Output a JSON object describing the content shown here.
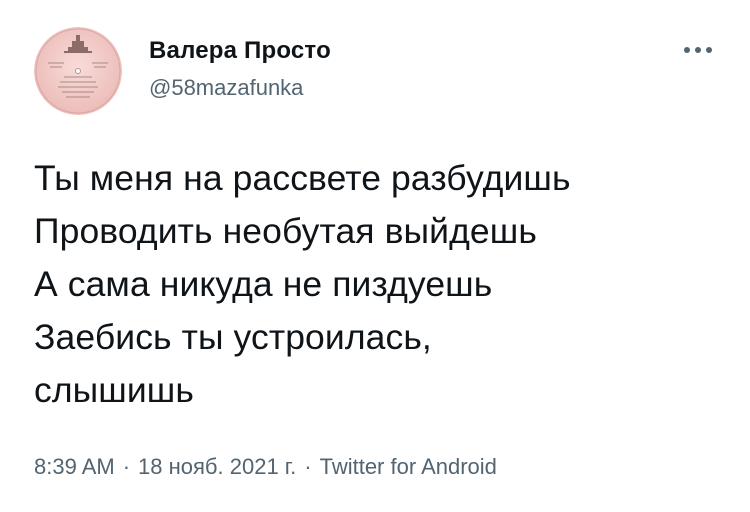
{
  "author": {
    "display_name": "Валера Просто",
    "handle": "@58mazafunka"
  },
  "tweet": {
    "lines": [
      "Ты меня на рассвете разбудишь",
      "Проводить необутая выйдешь",
      "А сама никуда не пиздуешь",
      "Заебись ты устроилась,",
      "слышишь"
    ],
    "time": "8:39 AM",
    "date": "18 нояб. 2021 г.",
    "source": "Twitter for Android",
    "separator": "·"
  },
  "colors": {
    "text": "#0f1419",
    "secondary": "#536471",
    "avatar_label": "#f2c9c6"
  },
  "icons": {
    "more": "more-horizontal-icon",
    "avatar": "vinyl-record-label-avatar"
  }
}
